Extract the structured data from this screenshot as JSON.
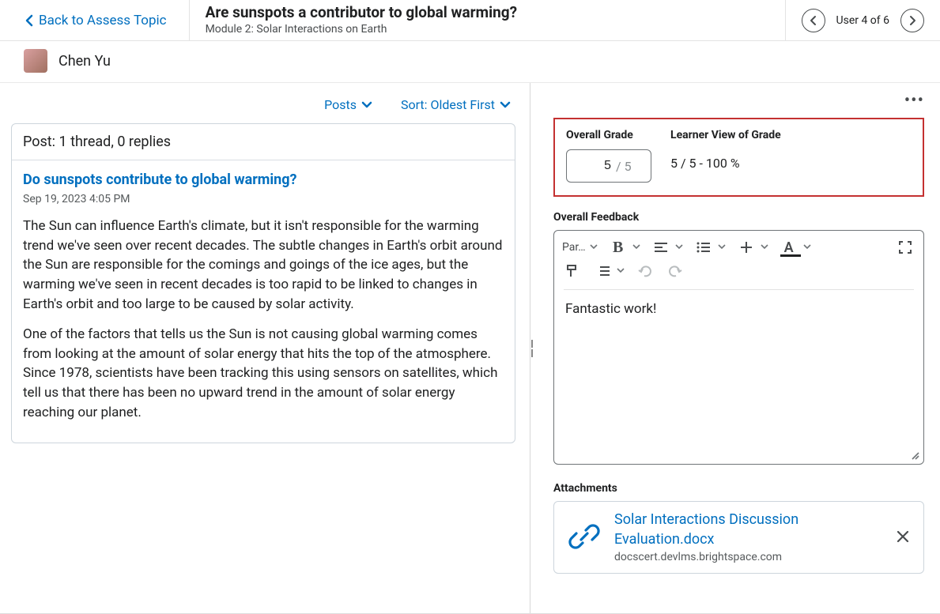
{
  "header": {
    "back_label": "Back to Assess Topic",
    "title": "Are sunspots a contributor to global warming?",
    "subtitle": "Module 2: Solar Interactions on Earth",
    "user_counter": "User 4 of 6"
  },
  "student": {
    "name": "Chen Yu"
  },
  "view": {
    "posts_label": "Posts",
    "sort_label": "Sort: Oldest First"
  },
  "post": {
    "summary": "Post: 1 thread, 0 replies",
    "title": "Do sunspots contribute to global warming?",
    "timestamp": "Sep 19, 2023 4:05 PM",
    "para1": "The Sun can influence Earth's climate, but it isn't responsible for the warming trend we've seen over recent decades. The subtle changes in Earth's orbit around the Sun are responsible for the comings and goings of the ice ages, but the warming we've seen in recent decades is too rapid to be linked to changes in Earth's orbit and too large to be caused by solar activity.",
    "para2": "One of the factors that tells us the Sun is not causing global warming comes from looking at the amount of solar energy that hits the top of the atmosphere. Since 1978, scientists have been tracking this using sensors on satellites, which tell us that there has been no upward trend in the amount of solar energy reaching our planet."
  },
  "grade": {
    "overall_label": "Overall Grade",
    "learner_label": "Learner View of Grade",
    "input_value": "5",
    "max_suffix": "/ 5",
    "learner_text": "5 / 5 - 100 %"
  },
  "feedback": {
    "section_title": "Overall Feedback",
    "toolbar_paragraph": "Par…",
    "content": "Fantastic work!"
  },
  "attachments": {
    "section_title": "Attachments",
    "file_title": "Solar Interactions Discussion Evaluation.docx",
    "file_domain": "docscert.devlms.brightspace.com"
  }
}
